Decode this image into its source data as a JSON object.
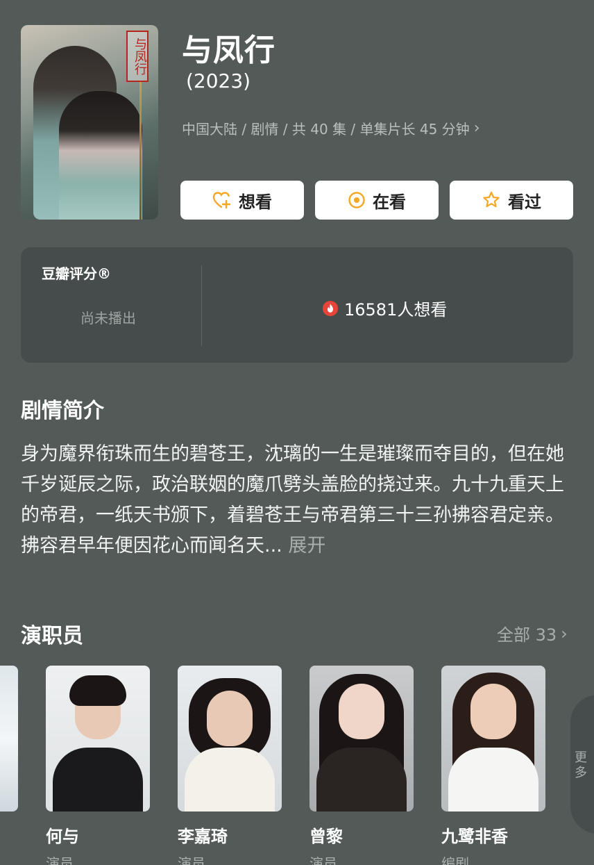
{
  "header": {
    "poster_title": "与凤行",
    "title": "与凤行",
    "year": "(2023)",
    "meta": "中国大陆 / 剧情 / 共 40 集 / 单集片长 45 分钟",
    "meta_chevron": "›"
  },
  "actions": {
    "want": "想看",
    "watching": "在看",
    "watched": "看过"
  },
  "rating": {
    "label": "豆瓣评分®",
    "status": "尚未播出",
    "wish_count": "16581人想看"
  },
  "synopsis": {
    "heading": "剧情简介",
    "text": "身为魔界衔珠而生的碧苍王，沈璃的一生是璀璨而夺目的，但在她千岁诞辰之际，政治联姻的魔爪劈头盖脸的挠过来。九十九重天上的帝君，一纸天书颁下，着碧苍王与帝君第三十三孙拂容君定亲。拂容君早年便因花心而闻名天...",
    "expand": "展开"
  },
  "cast": {
    "heading": "演职员",
    "all_label": "全部 33",
    "all_chevron": "›",
    "more_label": "更多",
    "members": [
      {
        "name": "何与",
        "role": "演员"
      },
      {
        "name": "李嘉琦",
        "role": "演员"
      },
      {
        "name": "曾黎",
        "role": "演员"
      },
      {
        "name": "九鹭非香",
        "role": "编剧"
      }
    ]
  },
  "colors": {
    "background": "#535a58",
    "card": "#464c4b",
    "accent_orange": "#f5a623",
    "hot_red": "#e8443a"
  }
}
